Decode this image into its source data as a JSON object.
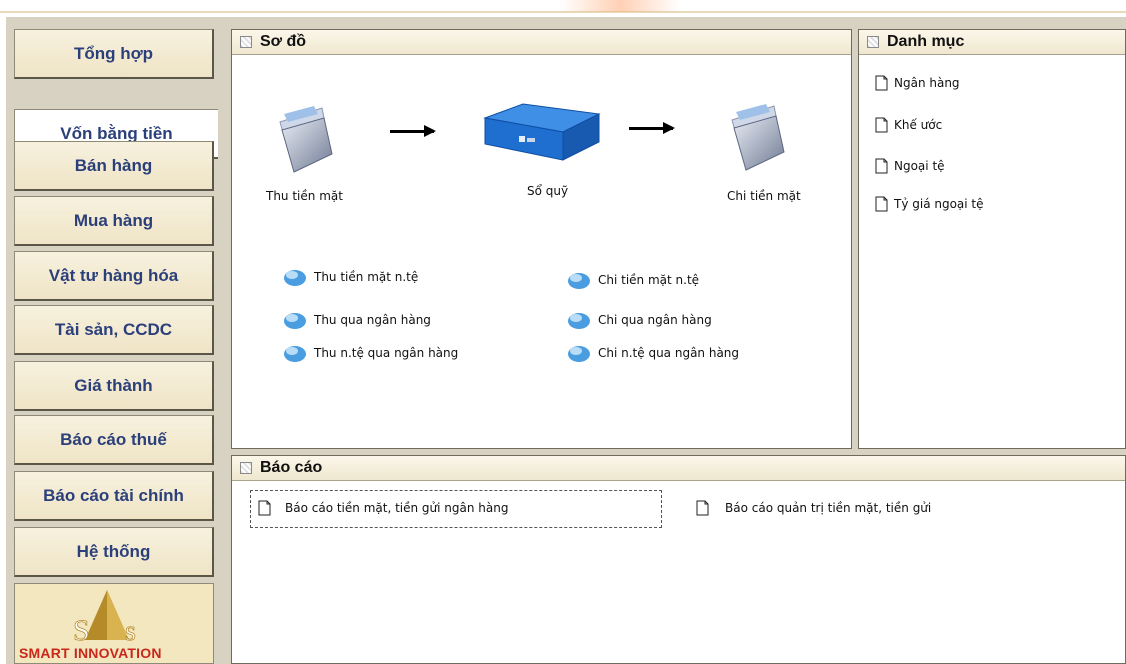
{
  "sidebar": {
    "items": [
      {
        "label": "Tổng hợp",
        "active": false
      },
      {
        "label": "Vốn bằng tiền",
        "active": true
      },
      {
        "label": "Bán hàng",
        "active": false
      },
      {
        "label": "Mua hàng",
        "active": false
      },
      {
        "label": "Vật tư hàng hóa",
        "active": false
      },
      {
        "label": "Tài sản, CCDC",
        "active": false
      },
      {
        "label": "Giá thành",
        "active": false
      },
      {
        "label": "Báo cáo thuế",
        "active": false
      },
      {
        "label": "Báo cáo tài chính",
        "active": false
      },
      {
        "label": "Hệ thống",
        "active": false
      }
    ],
    "logo_text": "SMART INNOVATION"
  },
  "diagram": {
    "title": "Sơ đồ",
    "flow": {
      "source": "Thu tiền mặt",
      "center": "Sổ quỹ",
      "target": "Chi tiền mặt"
    },
    "left_actions": [
      "Thu tiền mặt n.tệ",
      "Thu qua ngân hàng",
      "Thu n.tệ qua ngân hàng"
    ],
    "right_actions": [
      "Chi tiền mặt n.tệ",
      "Chi qua ngân hàng",
      "Chi n.tệ qua ngân hàng"
    ]
  },
  "catalog": {
    "title": "Danh mục",
    "items": [
      "Ngân hàng",
      "Khế ước",
      "Ngoại tệ",
      "Tỷ giá ngoại tệ"
    ]
  },
  "reports": {
    "title": "Báo cáo",
    "items": [
      "Báo cáo tiền mặt, tiền gửi ngân hàng",
      "Báo cáo quản trị tiền mặt, tiền gửi"
    ]
  },
  "colors": {
    "nav_text": "#2b3f7a",
    "logo_text": "#c8281c",
    "binder": "#1f6fd1",
    "header_bg": "#efe7cf"
  }
}
